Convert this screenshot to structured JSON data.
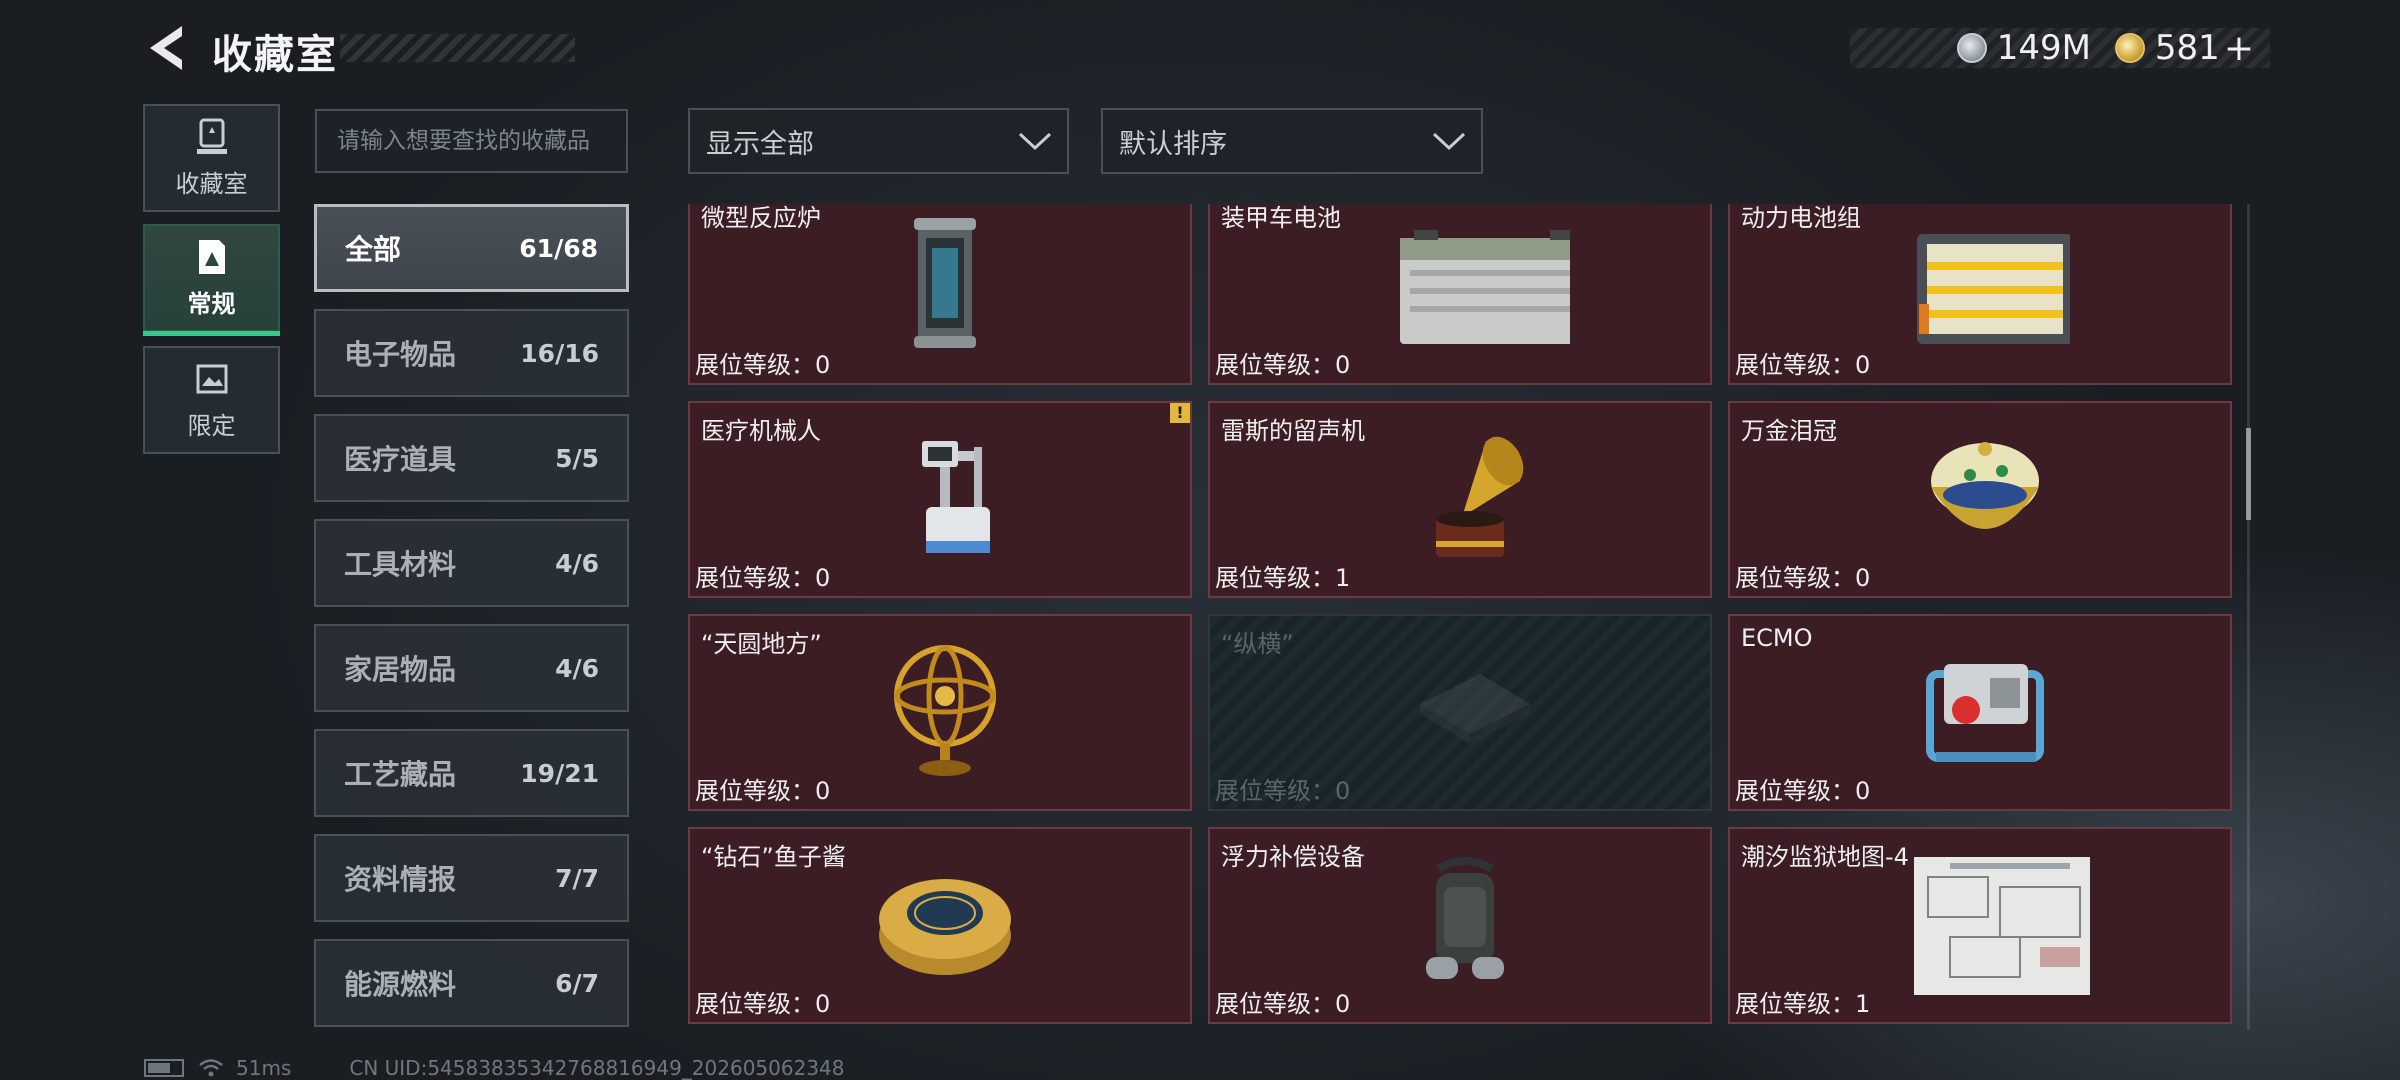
{
  "header": {
    "title": "收藏室",
    "currency": [
      {
        "icon": "silver-coin-icon",
        "value": "149M"
      },
      {
        "icon": "gold-coin-icon",
        "value": "581"
      }
    ],
    "plus_label": "+"
  },
  "side_tabs": [
    {
      "label": "收藏室",
      "icon": "trophy-icon"
    },
    {
      "label": "常规",
      "icon": "document-icon",
      "active": true
    },
    {
      "label": "限定",
      "icon": "image-icon"
    }
  ],
  "search": {
    "placeholder": "请输入想要查找的收藏品",
    "value": ""
  },
  "categories": [
    {
      "name": "全部",
      "count": "61/68",
      "active": true
    },
    {
      "name": "电子物品",
      "count": "16/16"
    },
    {
      "name": "医疗道具",
      "count": "5/5"
    },
    {
      "name": "工具材料",
      "count": "4/6"
    },
    {
      "name": "家居物品",
      "count": "4/6"
    },
    {
      "name": "工艺藏品",
      "count": "19/21"
    },
    {
      "name": "资料情报",
      "count": "7/7"
    },
    {
      "name": "能源燃料",
      "count": "6/7"
    }
  ],
  "filters": {
    "display": "显示全部",
    "sort": "默认排序"
  },
  "items": [
    {
      "name": "微型反应炉",
      "level_label": "展位等级：",
      "level": "0",
      "icon": "micro-reactor-icon"
    },
    {
      "name": "装甲车电池",
      "level_label": "展位等级：",
      "level": "0",
      "icon": "armored-battery-icon"
    },
    {
      "name": "动力电池组",
      "level_label": "展位等级：",
      "level": "0",
      "icon": "battery-pack-icon"
    },
    {
      "name": "医疗机械人",
      "level_label": "展位等级：",
      "level": "0",
      "icon": "medical-robot-icon",
      "badge": "!"
    },
    {
      "name": "雷斯的留声机",
      "level_label": "展位等级：",
      "level": "1",
      "icon": "gramophone-icon"
    },
    {
      "name": "万金泪冠",
      "level_label": "展位等级：",
      "level": "0",
      "icon": "jeweled-egg-icon"
    },
    {
      "name": "“天圆地方”",
      "level_label": "展位等级：",
      "level": "0",
      "icon": "armillary-sphere-icon"
    },
    {
      "name": "“纵横”",
      "level_label": "展位等级：",
      "level": "0",
      "icon": "chess-board-icon",
      "locked": true
    },
    {
      "name": "ECMO",
      "level_label": "展位等级：",
      "level": "0",
      "icon": "ecmo-icon"
    },
    {
      "name": "“钻石”鱼子酱",
      "level_label": "展位等级：",
      "level": "0",
      "icon": "caviar-tin-icon"
    },
    {
      "name": "浮力补偿设备",
      "level_label": "展位等级：",
      "level": "0",
      "icon": "buoyancy-device-icon"
    },
    {
      "name": "潮汐监狱地图-4",
      "level_label": "展位等级：",
      "level": "1",
      "icon": "map-sheet-icon"
    }
  ],
  "status": {
    "ping": "51ms",
    "uid": "CN UID:54583835342768816949_202605062348"
  }
}
